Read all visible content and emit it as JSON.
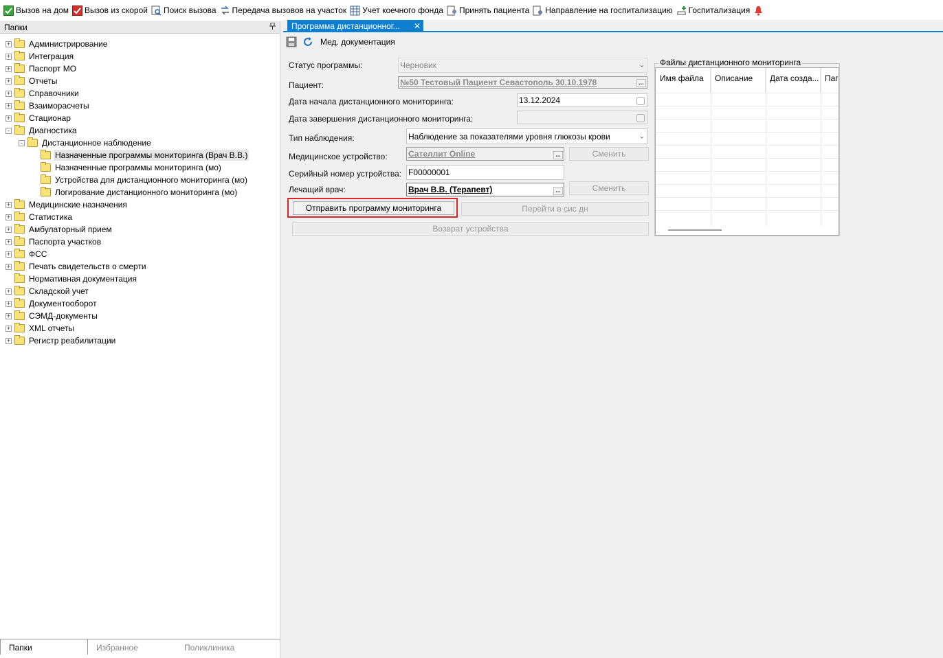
{
  "toolbar": {
    "items": [
      {
        "label": "Вызов на дом",
        "icon": "green-check-icon"
      },
      {
        "label": "Вызов из скорой",
        "icon": "red-check-icon"
      },
      {
        "label": "Поиск вызова",
        "icon": "search-call-icon"
      },
      {
        "label": "Передача вызовов на участок",
        "icon": "transfer-call-icon"
      },
      {
        "label": "Учет коечного фонда",
        "icon": "bed-fund-icon"
      },
      {
        "label": "Принять пациента",
        "icon": "accept-patient-icon"
      },
      {
        "label": "Направление на госпитализацию",
        "icon": "referral-icon"
      },
      {
        "label": "Госпитализация",
        "icon": "hospitalization-icon"
      }
    ],
    "bell_icon": "bell-icon"
  },
  "left_panel": {
    "title": "Папки",
    "tree": [
      {
        "label": "Администрирование",
        "expander": "+",
        "level": 0
      },
      {
        "label": "Интеграция",
        "expander": "+",
        "level": 0
      },
      {
        "label": "Паспорт МО",
        "expander": "+",
        "level": 0
      },
      {
        "label": "Отчеты",
        "expander": "+",
        "level": 0
      },
      {
        "label": "Справочники",
        "expander": "+",
        "level": 0
      },
      {
        "label": "Взаиморасчеты",
        "expander": "+",
        "level": 0
      },
      {
        "label": "Стационар",
        "expander": "+",
        "level": 0
      },
      {
        "label": "Диагностика",
        "expander": "-",
        "level": 0
      },
      {
        "label": "Дистанционное наблюдение",
        "expander": "-",
        "level": 1
      },
      {
        "label": "Назначенные программы мониторинга (Врач В.В.)",
        "expander": "",
        "level": 2,
        "selected": true
      },
      {
        "label": "Назначенные программы мониторинга (мо)",
        "expander": "",
        "level": 2
      },
      {
        "label": "Устройства для дистанционного мониторинга (мо)",
        "expander": "",
        "level": 2
      },
      {
        "label": "Логирование дистанционного мониторинга (мо)",
        "expander": "",
        "level": 2
      },
      {
        "label": "Медицинские назначения",
        "expander": "+",
        "level": 0
      },
      {
        "label": "Статистика",
        "expander": "+",
        "level": 0
      },
      {
        "label": "Амбулаторный прием",
        "expander": "+",
        "level": 0
      },
      {
        "label": "Паспорта участков",
        "expander": "+",
        "level": 0
      },
      {
        "label": "ФСС",
        "expander": "+",
        "level": 0
      },
      {
        "label": "Печать свидетельств о смерти",
        "expander": "+",
        "level": 0
      },
      {
        "label": "Нормативная документация",
        "expander": "",
        "level": 0
      },
      {
        "label": "Складской учет",
        "expander": "+",
        "level": 0
      },
      {
        "label": "Документооборот",
        "expander": "+",
        "level": 0
      },
      {
        "label": "СЭМД-документы",
        "expander": "+",
        "level": 0
      },
      {
        "label": "XML отчеты",
        "expander": "+",
        "level": 0
      },
      {
        "label": "Регистр реабилитации",
        "expander": "+",
        "level": 0
      }
    ],
    "bottom_tabs": [
      "Папки",
      "Избранное",
      "Поликлиника"
    ]
  },
  "document": {
    "tab_title": "Программа дистанционног...",
    "toolbar_label": "Мед. документация",
    "form": {
      "status_label": "Статус программы:",
      "status_value": "Черновик",
      "patient_label": "Пациент:",
      "patient_value": "№50 Тестовый Пациент Севастополь 30.10.1978",
      "start_label": "Дата начала дистанционного мониторинга:",
      "start_value": "13.12.2024",
      "end_label": "Дата завершения дистанционного мониторинга:",
      "end_value": "",
      "type_label": "Тип наблюдения:",
      "type_value": "Наблюдение за показателями уровня глюкозы крови",
      "device_label": "Медицинское устройство:",
      "device_value": "Сателлит Online",
      "serial_label": "Серийный номер устройства:",
      "serial_value": "F00000001",
      "doctor_label": "Лечащий врач:",
      "doctor_value": "Врач В.В. (Терапевт)",
      "change_label_1": "Сменить",
      "change_label_2": "Сменить",
      "send_button": "Отправить программу мониторинга",
      "goto_button": "Перейти в сис дн",
      "return_button": "Возврат устройства"
    },
    "files": {
      "title": "Файлы дистанционного мониторинга",
      "columns": [
        "Имя файла",
        "Описание",
        "Дата созда...",
        "Паг"
      ]
    }
  }
}
